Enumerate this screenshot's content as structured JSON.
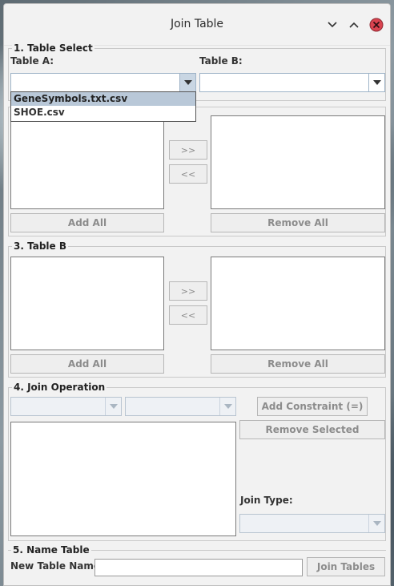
{
  "window": {
    "title": "Join Table"
  },
  "section1": {
    "legend": "1. Table Select",
    "table_a_label": "Table A:",
    "table_b_label": "Table B:",
    "table_a_value": "",
    "table_b_value": "",
    "dropdown_options": [
      "GeneSymbols.txt.csv",
      "SHOE.csv"
    ],
    "selected_option": "GeneSymbols.txt.csv"
  },
  "section2": {
    "add_label": ">>",
    "remove_label": "<<",
    "add_all_label": "Add All",
    "remove_all_label": "Remove All"
  },
  "section3": {
    "legend": "3. Table B",
    "add_label": ">>",
    "remove_label": "<<",
    "add_all_label": "Add All",
    "remove_all_label": "Remove All"
  },
  "section4": {
    "legend": "4. Join Operation",
    "add_constraint_label": "Add Constraint (=)",
    "remove_selected_label": "Remove Selected",
    "join_type_label": "Join Type:"
  },
  "section5": {
    "legend": "5. Name Table",
    "name_label": "New Table Name:",
    "name_value": "",
    "join_tables_label": "Join Tables"
  },
  "colors": {
    "window_bg": "#f2f2f2",
    "close_button": "#d9434f",
    "selection": "#b9c8d8"
  }
}
